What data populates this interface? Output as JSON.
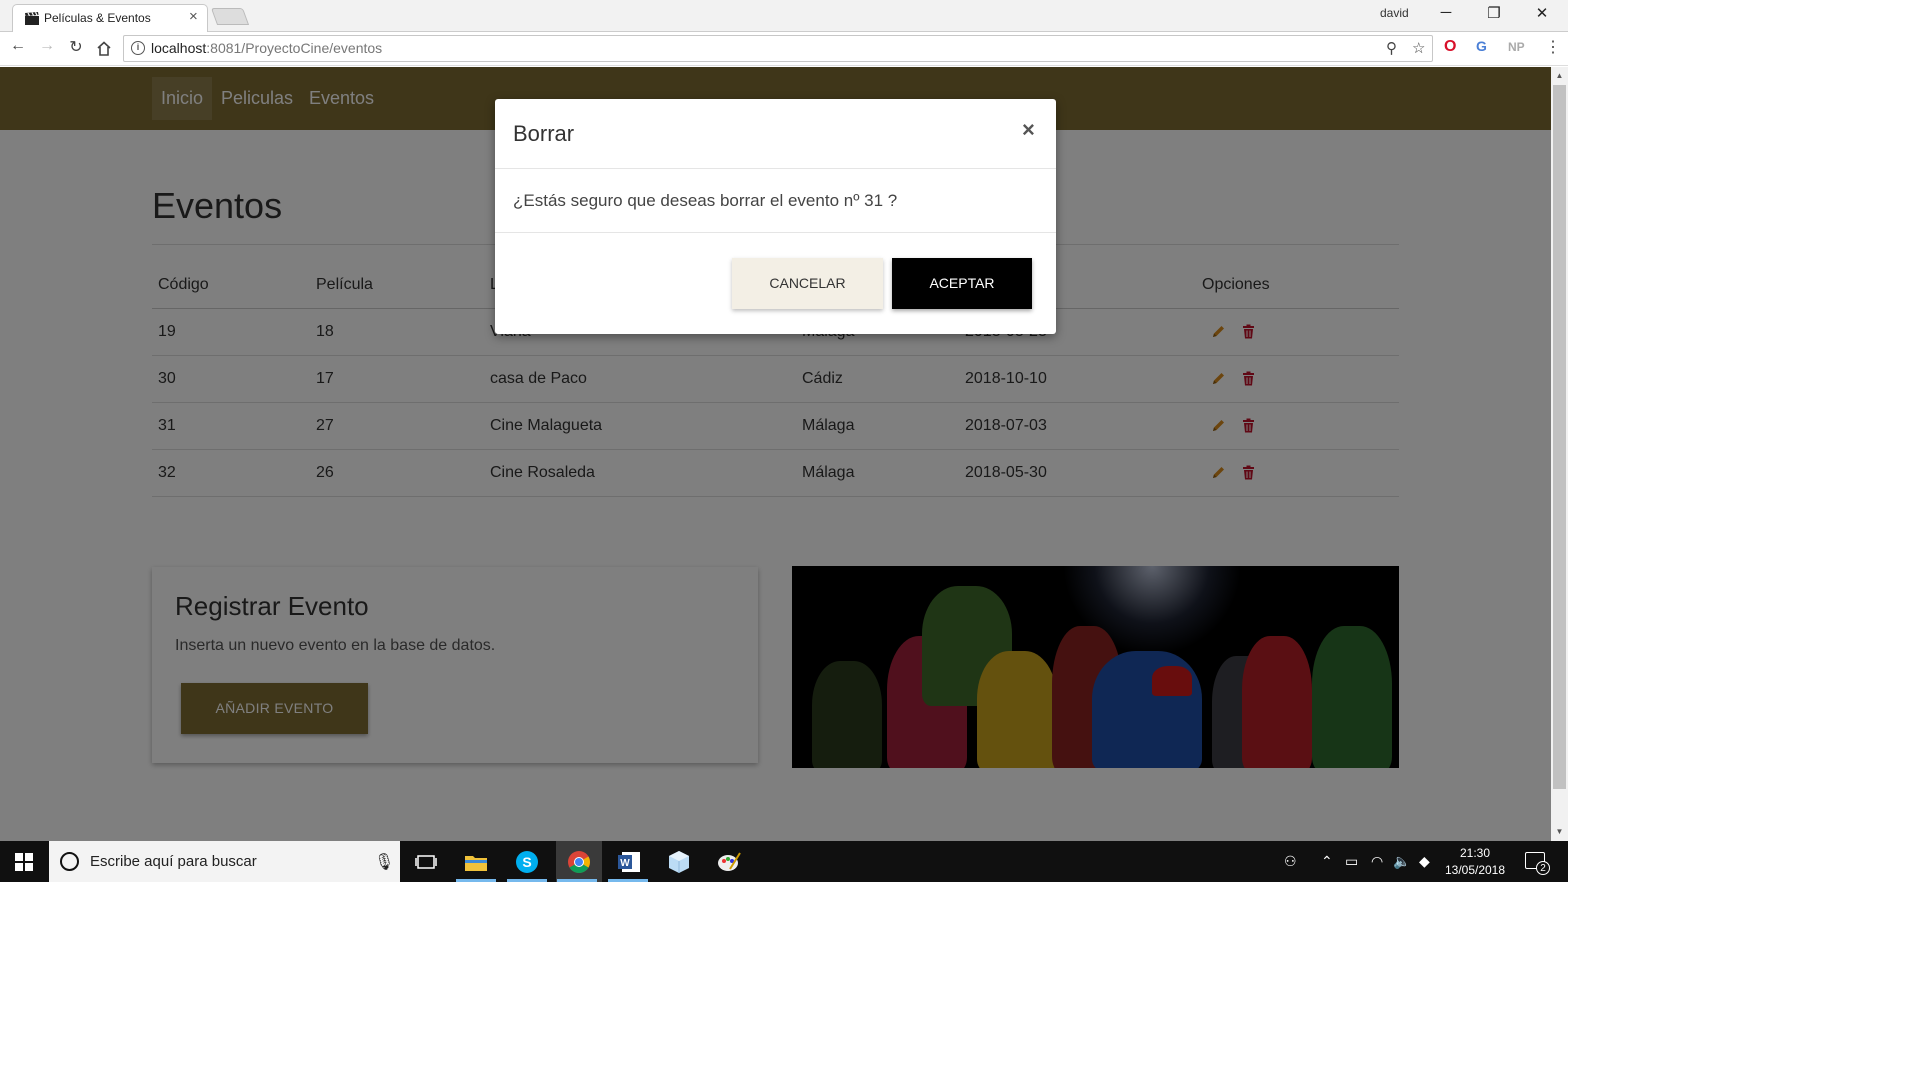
{
  "browser": {
    "tab_title": "Películas & Eventos",
    "profile_name": "david",
    "url_host": "localhost",
    "url_rest": ":8081/ProyectoCine/eventos",
    "extensions": [
      "opera-icon",
      "translate-icon",
      "NP"
    ]
  },
  "navbar": {
    "links": [
      "Inicio",
      "Peliculas",
      "Eventos"
    ],
    "active": "Inicio"
  },
  "page": {
    "title": "Eventos"
  },
  "table": {
    "headers": [
      "Código",
      "Película",
      "L",
      "",
      "",
      "Opciones"
    ],
    "rows": [
      [
        "19",
        "18",
        "Viaña",
        "Málaga",
        "2018-08-28"
      ],
      [
        "30",
        "17",
        "casa de Paco",
        "Cádiz",
        "2018-10-10"
      ],
      [
        "31",
        "27",
        "Cine Malagueta",
        "Málaga",
        "2018-07-03"
      ],
      [
        "32",
        "26",
        "Cine Rosaleda",
        "Málaga",
        "2018-05-30"
      ]
    ]
  },
  "card": {
    "title": "Registrar Evento",
    "text": "Inserta un nuevo evento en la base de datos.",
    "button": "AÑADIR EVENTO"
  },
  "modal": {
    "title": "Borrar",
    "close": "×",
    "body": "¿Estás seguro que deseas borrar el evento nº 31 ?",
    "cancel": "CANCELAR",
    "accept": "ACEPTAR"
  },
  "taskbar": {
    "search_placeholder": "Escribe aquí para buscar",
    "time": "21:30",
    "date": "13/05/2018",
    "notifications": "2"
  },
  "colors": {
    "navbar": "#7f6d33",
    "accept_button": "#000000",
    "cancel_button": "#f3efe5",
    "edit_icon": "#d88a1c",
    "delete_icon": "#c0102a"
  }
}
